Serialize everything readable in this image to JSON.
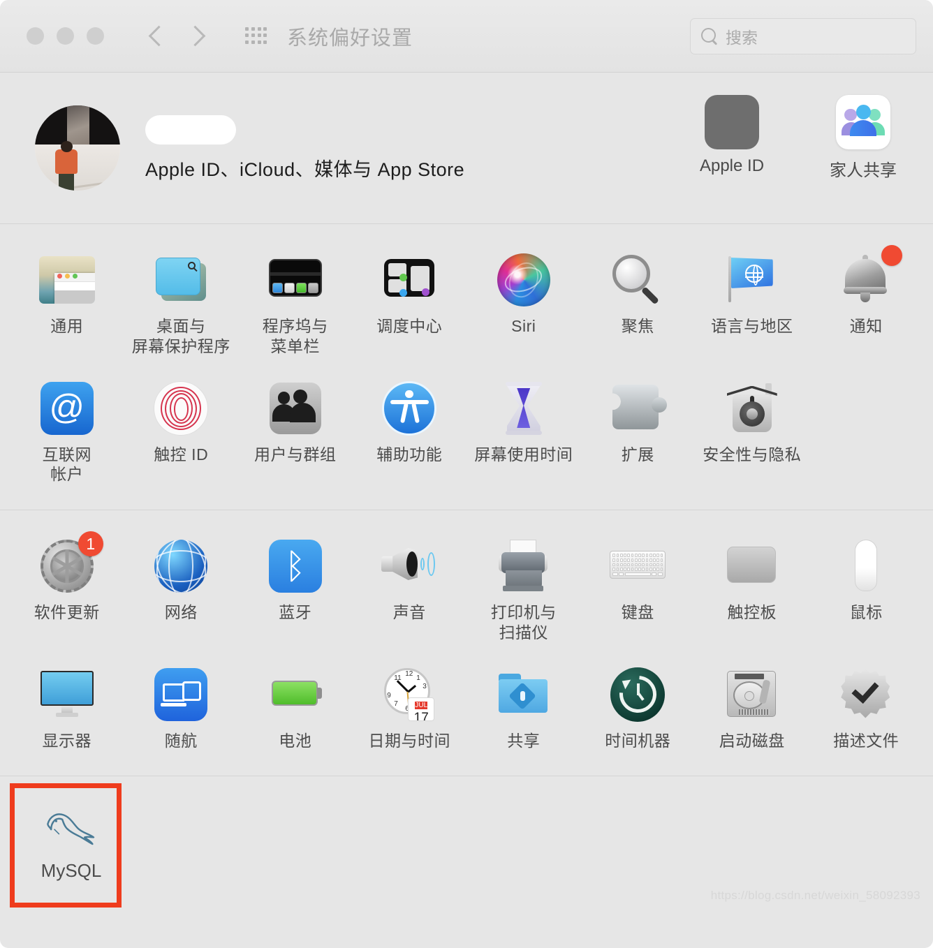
{
  "window": {
    "title": "系统偏好设置",
    "traffic_lights": [
      "close",
      "minimize",
      "zoom"
    ],
    "nav": {
      "back": "back-chevron",
      "forward": "forward-chevron",
      "grid": "show-all-grid"
    },
    "search": {
      "placeholder": "搜索",
      "value": "",
      "icon": "search-icon"
    }
  },
  "account": {
    "name_redacted": "",
    "subtitle": "Apple ID、iCloud、媒体与 App Store",
    "avatar": "user-photo",
    "panes": [
      {
        "label": "Apple ID",
        "icon": "apple-id-icon"
      },
      {
        "label": "家人共享",
        "icon": "family-sharing-icon"
      }
    ]
  },
  "sections": [
    {
      "id": "personal",
      "panes": [
        {
          "label": "通用",
          "icon": "general-icon",
          "badge": ""
        },
        {
          "label": "桌面与\n屏幕保护程序",
          "icon": "desktop-screensaver-icon",
          "badge": ""
        },
        {
          "label": "程序坞与\n菜单栏",
          "icon": "dock-menubar-icon",
          "badge": ""
        },
        {
          "label": "调度中心",
          "icon": "mission-control-icon",
          "badge": ""
        },
        {
          "label": "Siri",
          "icon": "siri-icon",
          "badge": ""
        },
        {
          "label": "聚焦",
          "icon": "spotlight-icon",
          "badge": ""
        },
        {
          "label": "语言与地区",
          "icon": "language-region-icon",
          "badge": ""
        },
        {
          "label": "通知",
          "icon": "notifications-icon",
          "badge": "dot"
        },
        {
          "label": "互联网\n帐户",
          "icon": "internet-accounts-icon",
          "badge": ""
        },
        {
          "label": "触控 ID",
          "icon": "touch-id-icon",
          "badge": ""
        },
        {
          "label": "用户与群组",
          "icon": "users-groups-icon",
          "badge": ""
        },
        {
          "label": "辅助功能",
          "icon": "accessibility-icon",
          "badge": ""
        },
        {
          "label": "屏幕使用时间",
          "icon": "screen-time-icon",
          "badge": ""
        },
        {
          "label": "扩展",
          "icon": "extensions-icon",
          "badge": ""
        },
        {
          "label": "安全性与隐私",
          "icon": "security-privacy-icon",
          "badge": ""
        }
      ]
    },
    {
      "id": "hardware",
      "panes": [
        {
          "label": "软件更新",
          "icon": "software-update-icon",
          "badge": "1"
        },
        {
          "label": "网络",
          "icon": "network-icon",
          "badge": ""
        },
        {
          "label": "蓝牙",
          "icon": "bluetooth-icon",
          "badge": ""
        },
        {
          "label": "声音",
          "icon": "sound-icon",
          "badge": ""
        },
        {
          "label": "打印机与\n扫描仪",
          "icon": "printers-scanners-icon",
          "badge": ""
        },
        {
          "label": "键盘",
          "icon": "keyboard-icon",
          "badge": ""
        },
        {
          "label": "触控板",
          "icon": "trackpad-icon",
          "badge": ""
        },
        {
          "label": "鼠标",
          "icon": "mouse-icon",
          "badge": ""
        },
        {
          "label": "显示器",
          "icon": "displays-icon",
          "badge": ""
        },
        {
          "label": "随航",
          "icon": "sidecar-icon",
          "badge": ""
        },
        {
          "label": "电池",
          "icon": "battery-icon",
          "badge": ""
        },
        {
          "label": "日期与时间",
          "icon": "date-time-icon",
          "badge": ""
        },
        {
          "label": "共享",
          "icon": "sharing-icon",
          "badge": ""
        },
        {
          "label": "时间机器",
          "icon": "time-machine-icon",
          "badge": ""
        },
        {
          "label": "启动磁盘",
          "icon": "startup-disk-icon",
          "badge": ""
        },
        {
          "label": "描述文件",
          "icon": "profiles-icon",
          "badge": ""
        }
      ]
    }
  ],
  "third_party": {
    "panes": [
      {
        "label": "MySQL",
        "icon": "mysql-dolphin-icon",
        "highlighted": true
      }
    ],
    "highlight_color": "#ef3c1d"
  },
  "clock_icon": {
    "month": "JUL",
    "day": "17"
  },
  "watermark": "https://blog.csdn.net/weixin_58092393"
}
